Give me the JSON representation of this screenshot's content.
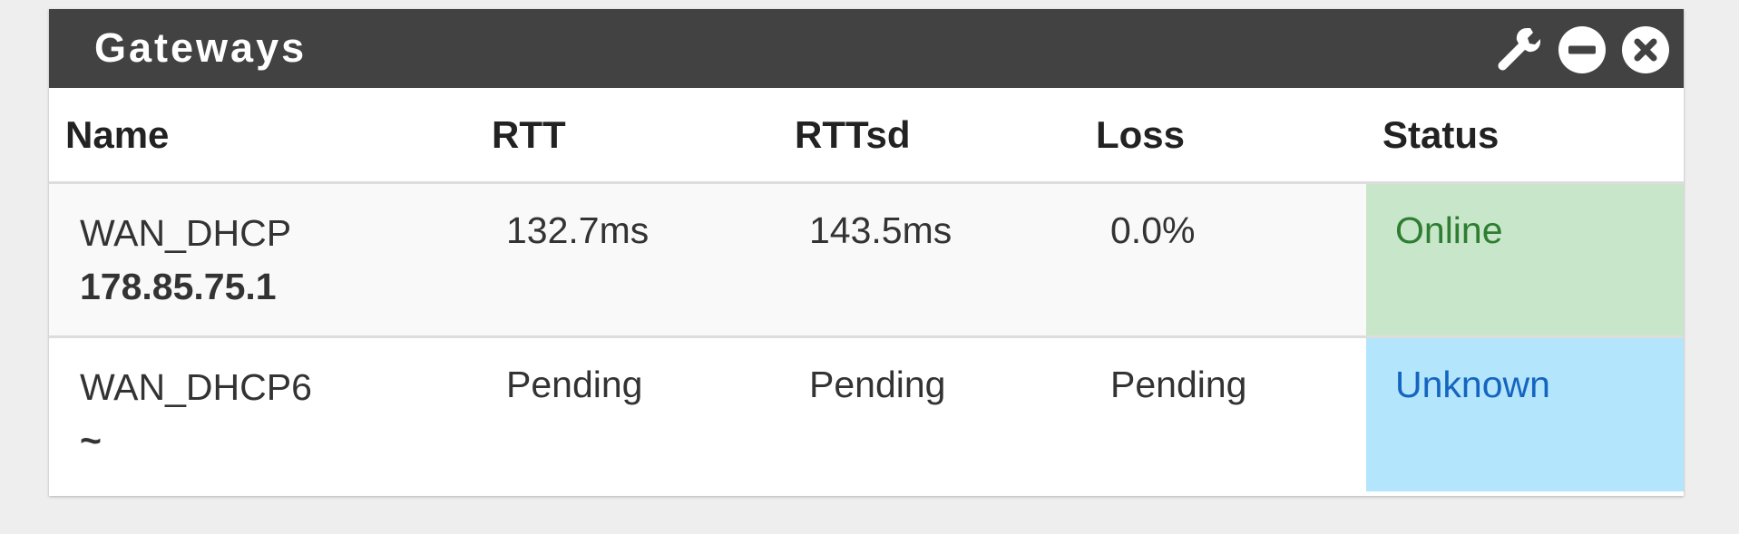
{
  "widget": {
    "title": "Gateways",
    "icons": [
      "wrench-icon",
      "minus-circle-icon",
      "close-circle-icon"
    ]
  },
  "table": {
    "headers": [
      "Name",
      "RTT",
      "RTTsd",
      "Loss",
      "Status"
    ],
    "rows": [
      {
        "name": "WAN_DHCP",
        "address": "178.85.75.1",
        "rtt": "132.7ms",
        "rttsd": "143.5ms",
        "loss": "0.0%",
        "status": "Online"
      },
      {
        "name": "WAN_DHCP6",
        "address": "~",
        "rtt": "Pending",
        "rttsd": "Pending",
        "loss": "Pending",
        "status": "Unknown"
      }
    ]
  },
  "colors": {
    "header_bg": "#424242",
    "online_bg": "#c8e6c9",
    "online_text": "#2e7d32",
    "unknown_bg": "#b3e5fc",
    "unknown_text": "#1565c0"
  }
}
